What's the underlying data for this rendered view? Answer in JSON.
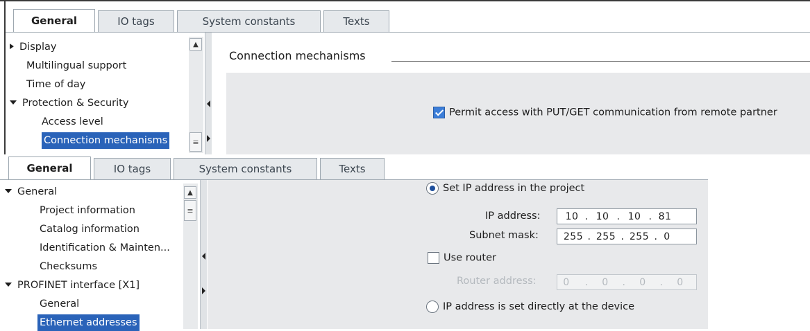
{
  "top": {
    "tabs": [
      {
        "label": "General",
        "active": true
      },
      {
        "label": "IO tags",
        "active": false
      },
      {
        "label": "System constants",
        "active": false
      },
      {
        "label": "Texts",
        "active": false
      }
    ],
    "nav": [
      {
        "label": "Display",
        "expander": "collapsed",
        "indent": 0
      },
      {
        "label": "Multilingual support",
        "expander": "none",
        "indent": 0
      },
      {
        "label": "Time of day",
        "expander": "none",
        "indent": 0
      },
      {
        "label": "Protection & Security",
        "expander": "expanded",
        "indent": 0
      },
      {
        "label": "Access level",
        "expander": "none",
        "indent": 1
      },
      {
        "label": "Connection mechanisms",
        "expander": "none",
        "indent": 1,
        "selected": true
      }
    ],
    "section_title": "Connection mechanisms",
    "permit_checkbox": {
      "label": "Permit access with PUT/GET communication from remote partner",
      "checked": true
    }
  },
  "bottom": {
    "tabs": [
      {
        "label": "General",
        "active": true
      },
      {
        "label": "IO tags",
        "active": false
      },
      {
        "label": "System constants",
        "active": false
      },
      {
        "label": "Texts",
        "active": false
      }
    ],
    "nav": [
      {
        "label": "General",
        "expander": "expanded",
        "indent": 0
      },
      {
        "label": "Project information",
        "expander": "none",
        "indent": 1
      },
      {
        "label": "Catalog information",
        "expander": "none",
        "indent": 1
      },
      {
        "label": "Identification & Mainten...",
        "expander": "none",
        "indent": 1
      },
      {
        "label": "Checksums",
        "expander": "none",
        "indent": 1
      },
      {
        "label": "PROFINET interface [X1]",
        "expander": "expanded",
        "indent": 0
      },
      {
        "label": "General",
        "expander": "none",
        "indent": 1
      },
      {
        "label": "Ethernet addresses",
        "expander": "none",
        "indent": 1,
        "selected": true
      }
    ],
    "set_ip_radio": {
      "label": "Set IP address in the project",
      "checked": true
    },
    "ip_address": {
      "label": "IP address:",
      "octets": [
        "10",
        "10",
        "10",
        "81"
      ]
    },
    "subnet_mask": {
      "label": "Subnet mask:",
      "octets": [
        "255",
        "255",
        "255",
        "0"
      ]
    },
    "use_router": {
      "label": "Use router",
      "checked": false
    },
    "router_address": {
      "label": "Router address:",
      "octets": [
        "0",
        "0",
        "0",
        "0"
      ],
      "disabled": true
    },
    "device_ip_radio": {
      "label": "IP address is set directly at the device",
      "checked": false
    }
  },
  "colors": {
    "selection": "#2a63b9",
    "checkbox_on": "#3b7dd8",
    "panel_gray": "#e8e9eb"
  }
}
